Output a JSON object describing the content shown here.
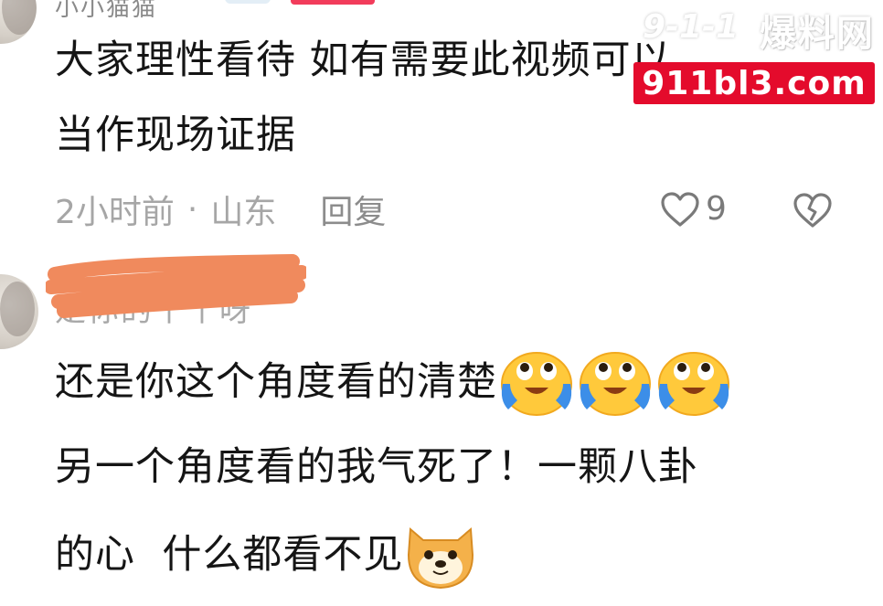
{
  "top_comment": {
    "author": "小小猫猫",
    "text_line1": "大家理性看待 如有需要此视频可以",
    "text_line2": "当作现场证据",
    "time": "2小时前",
    "separator": "·",
    "location": "山东",
    "reply_label": "回复",
    "like_count": "9",
    "like_icon": "heart-outline-icon",
    "dislike_icon": "broken-heart-icon"
  },
  "second_comment": {
    "author": "是你的丫丫呀",
    "text_line1": "还是你这个角度看的清楚",
    "text_line2": "另一个角度看的我气死了！一颗八卦",
    "text_line3": "的心  什么都看不见",
    "emoji_line1": [
      "crying-laughing-emoji",
      "crying-laughing-emoji",
      "crying-laughing-emoji"
    ],
    "emoji_line3": "doge-emoji"
  },
  "watermark": {
    "logo": "9-1-1",
    "title": "爆料网",
    "domain": "911bl3.com",
    "accent": "#e40b2c"
  },
  "colors": {
    "meta_gray": "#a6a6a6",
    "redaction": "#f08a5d"
  }
}
